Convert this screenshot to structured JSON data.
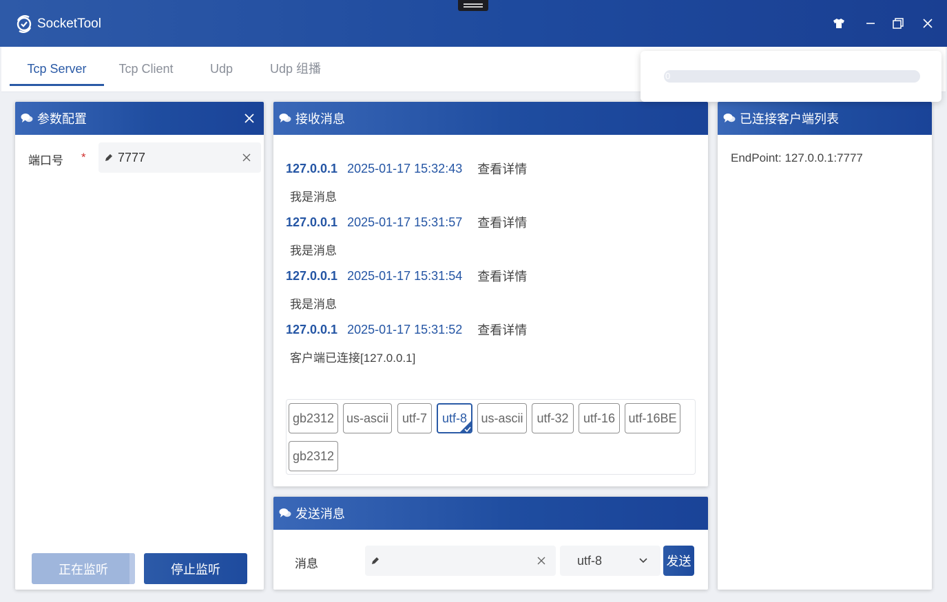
{
  "app": {
    "title": "SocketTool"
  },
  "tabs": [
    {
      "label": "Tcp Server",
      "active": true
    },
    {
      "label": "Tcp Client",
      "active": false
    },
    {
      "label": "Udp",
      "active": false
    },
    {
      "label": "Udp 组播",
      "active": false
    }
  ],
  "popup": {
    "progress_value": 0,
    "progress_label": "0"
  },
  "params_panel": {
    "title": "参数配置",
    "port_label": "端口号",
    "required_mark": "*",
    "port_value": "7777",
    "listening_button": "正在监听",
    "stop_button": "停止监听"
  },
  "receive_panel": {
    "title": "接收消息",
    "messages": [
      {
        "ip": "127.0.0.1",
        "time": "2025-01-17 15:32:43",
        "detail": "查看详情",
        "body": "我是消息"
      },
      {
        "ip": "127.0.0.1",
        "time": "2025-01-17 15:31:57",
        "detail": "查看详情",
        "body": "我是消息"
      },
      {
        "ip": "127.0.0.1",
        "time": "2025-01-17 15:31:54",
        "detail": "查看详情",
        "body": "我是消息"
      },
      {
        "ip": "127.0.0.1",
        "time": "2025-01-17 15:31:52",
        "detail": "查看详情",
        "body": "客户端已连接[127.0.0.1]"
      }
    ],
    "encodings": [
      "gb2312",
      "us-ascii",
      "utf-7",
      "utf-8",
      "us-ascii",
      "utf-32",
      "utf-16",
      "utf-16BE",
      "gb2312"
    ],
    "selected_encoding": "utf-8"
  },
  "send_panel": {
    "title": "发送消息",
    "message_label": "消息",
    "message_value": "",
    "encoding_value": "utf-8",
    "send_button": "发送"
  },
  "clients_panel": {
    "title": "已连接客户端列表",
    "clients": [
      "EndPoint: 127.0.0.1:7777"
    ]
  },
  "colors": {
    "accent": "#2a5aa6",
    "titlebar": "#1e4a9e",
    "required": "#d0302f"
  },
  "icons": [
    "app-logo-icon",
    "shirt-icon",
    "minimize-icon",
    "restore-icon",
    "close-icon",
    "chat-icon",
    "pencil-icon",
    "clear-icon",
    "chevron-down-icon",
    "check-icon"
  ]
}
